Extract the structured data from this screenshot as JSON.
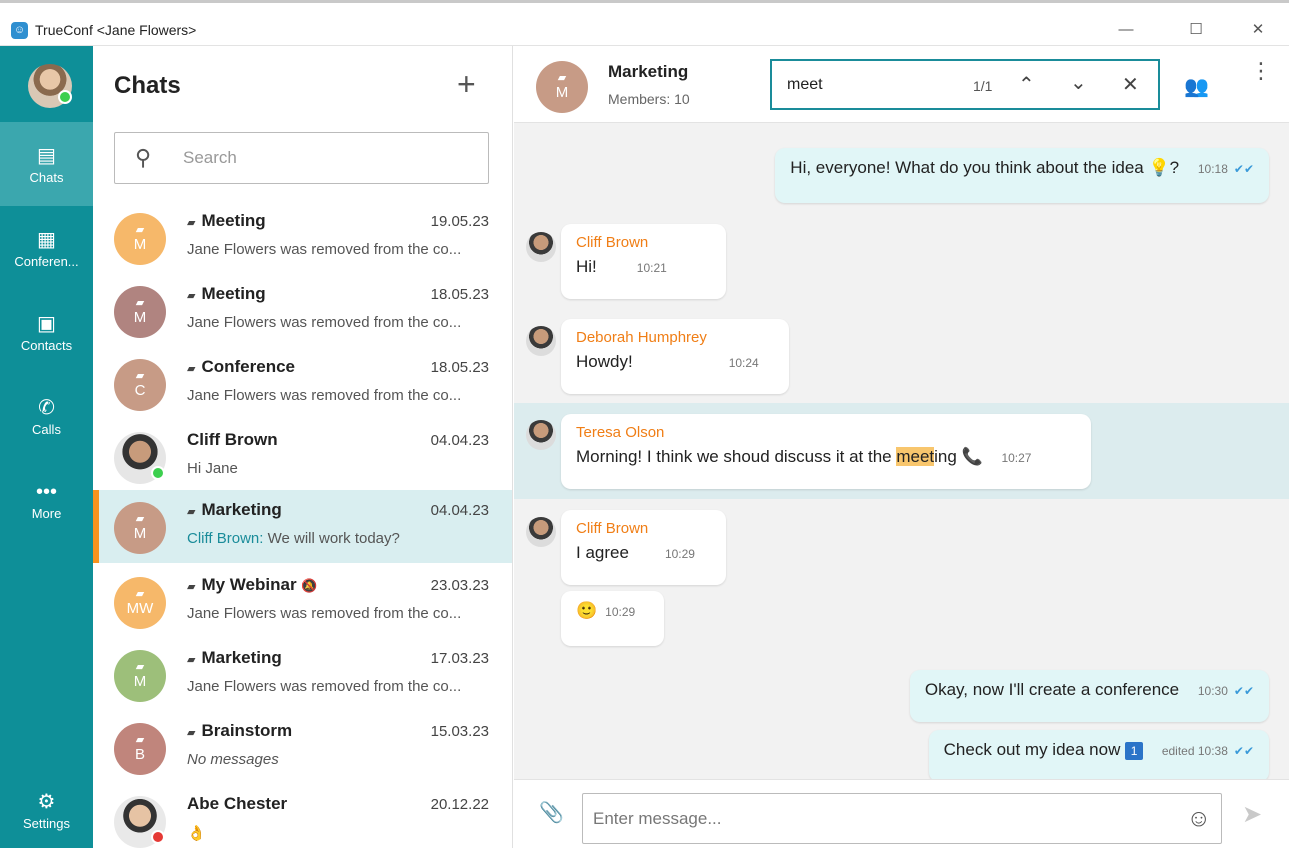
{
  "window": {
    "title": "TrueConf <Jane Flowers>"
  },
  "nav": {
    "items": [
      {
        "label": "Chats"
      },
      {
        "label": "Conferen..."
      },
      {
        "label": "Contacts"
      },
      {
        "label": "Calls"
      },
      {
        "label": "More"
      },
      {
        "label": "Settings"
      }
    ]
  },
  "chats": {
    "header": "Chats",
    "search_placeholder": "Search",
    "rows": [
      {
        "initial": "M",
        "name": "Meeting",
        "date": "19.05.23",
        "preview": "Jane Flowers was removed from the co...",
        "color": "#f6b86a"
      },
      {
        "initial": "M",
        "name": "Meeting",
        "date": "18.05.23",
        "preview": "Jane Flowers was removed from the co...",
        "color": "#b08480"
      },
      {
        "initial": "C",
        "name": "Conference",
        "date": "18.05.23",
        "preview": "Jane Flowers was removed from the co...",
        "color": "#c79b86"
      },
      {
        "initial": "",
        "name": "Cliff Brown",
        "date": "04.04.23",
        "preview": "Hi Jane",
        "color": "#555"
      },
      {
        "initial": "M",
        "name": "Marketing",
        "date": "04.04.23",
        "preview_sender": "Cliff Brown:",
        "preview": "We will work today?",
        "color": "#c79b86"
      },
      {
        "initial": "MW",
        "name": "My Webinar",
        "date": "23.03.23",
        "preview": "Jane Flowers was removed from the co...",
        "color": "#f6b86a"
      },
      {
        "initial": "M",
        "name": "Marketing",
        "date": "17.03.23",
        "preview": "Jane Flowers was removed from the co...",
        "color": "#9dbf7a"
      },
      {
        "initial": "B",
        "name": "Brainstorm",
        "date": "15.03.23",
        "preview": "No messages",
        "color": "#c0857c"
      },
      {
        "initial": "",
        "name": "Abe Chester",
        "date": "20.12.22",
        "preview": "",
        "color": "#ddd"
      }
    ]
  },
  "conversation": {
    "title": "Marketing",
    "avatar_initial": "M",
    "members": "Members: 10",
    "find": {
      "query": "meet",
      "count": "1/1"
    },
    "messages": [
      {
        "text": "Hi, everyone! What do you think about the idea",
        "suffix": "?",
        "time": "10:18"
      },
      {
        "sender": "Cliff Brown",
        "text": "Hi!",
        "time": "10:21"
      },
      {
        "sender": "Deborah Humphrey",
        "text": "Howdy!",
        "time": "10:24"
      },
      {
        "sender": "Teresa Olson",
        "text_before": "Morning! I think we shoud discuss it at the ",
        "text_match": "meet",
        "text_after": "ing",
        "time": "10:27"
      },
      {
        "sender": "Cliff Brown",
        "text": "I agree",
        "time": "10:29"
      },
      {
        "text": "",
        "time": "10:29"
      },
      {
        "text": "Okay, now I'll create a conference",
        "time": "10:30"
      },
      {
        "text": "Check out my idea now",
        "badge": "1",
        "time": "edited 10:38"
      }
    ],
    "composer_placeholder": "Enter message..."
  }
}
